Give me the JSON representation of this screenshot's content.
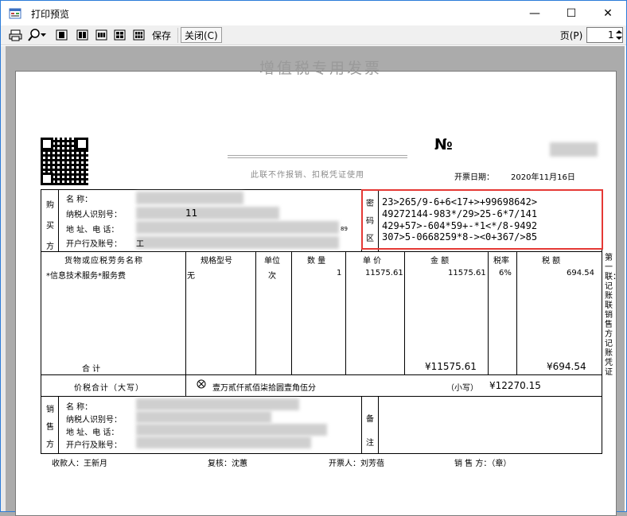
{
  "window": {
    "title": "打印预览",
    "minimize": "—",
    "maximize": "☐",
    "close": "✕"
  },
  "toolbar": {
    "save_label": "保存",
    "close_label": "关闭(C)",
    "page_label": "页(P)",
    "page_value": "1"
  },
  "invoice": {
    "title": "增值税专用发票",
    "subtitle": "此联不作报销、扣税凭证使用",
    "no_label": "№",
    "date_label": "开票日期：",
    "date_value": "2020年11月16日",
    "buyer": {
      "side_label": [
        "购",
        "买",
        "方"
      ],
      "name_label": "名       称：",
      "taxid_label": "纳税人识别号：",
      "taxid_partial": "11",
      "addr_label": "地  址、电  话：",
      "addr_partial": "89",
      "bank_label": "开户行及账号：",
      "bank_partial": "工"
    },
    "cipher_side": [
      "密",
      "码",
      "区"
    ],
    "cipher_lines": [
      "23>265/9-6+6<17+>+99698642>",
      "49272144-983*/29>25-6*7/141",
      "429+57>-604*59+-*1<*/8-9492",
      "307>5-0668259*8-><0+367/>85"
    ],
    "headers": {
      "item": "货物或应税劳务名称",
      "spec": "规格型号",
      "unit": "单位",
      "qty": "数  量",
      "price": "单  价",
      "amount": "金    额",
      "rate": "税率",
      "tax": "税    额"
    },
    "row": {
      "item": "*信息技术服务*服务费",
      "spec": "无",
      "unit": "次",
      "qty": "1",
      "price": "11575.61",
      "amount": "11575.61",
      "rate": "6%",
      "tax": "694.54"
    },
    "total_label": "合        计",
    "total_amount": "¥11575.61",
    "total_tax": "¥694.54",
    "sum_label": "价税合计（大写）",
    "sum_words": "壹万贰仟贰佰柒拾圆壹角伍分",
    "sum_small_label": "（小写）",
    "sum_small": "¥12270.15",
    "seller": {
      "side_label": [
        "销",
        "售",
        "方"
      ],
      "name_label": "名       称：",
      "taxid_label": "纳税人识别号：",
      "addr_label": "地  址、电  话：",
      "bank_label": "开户行及账号："
    },
    "remark_label": [
      "备",
      "注"
    ],
    "side_note": "第一联：记账联 销售方记账凭证",
    "footer": {
      "payee": "收款人：王新月",
      "reviewer": "复核：沈蕙",
      "issuer": "开票人：刘芳蓓",
      "seller_seal": "销 售 方：（章）"
    }
  }
}
